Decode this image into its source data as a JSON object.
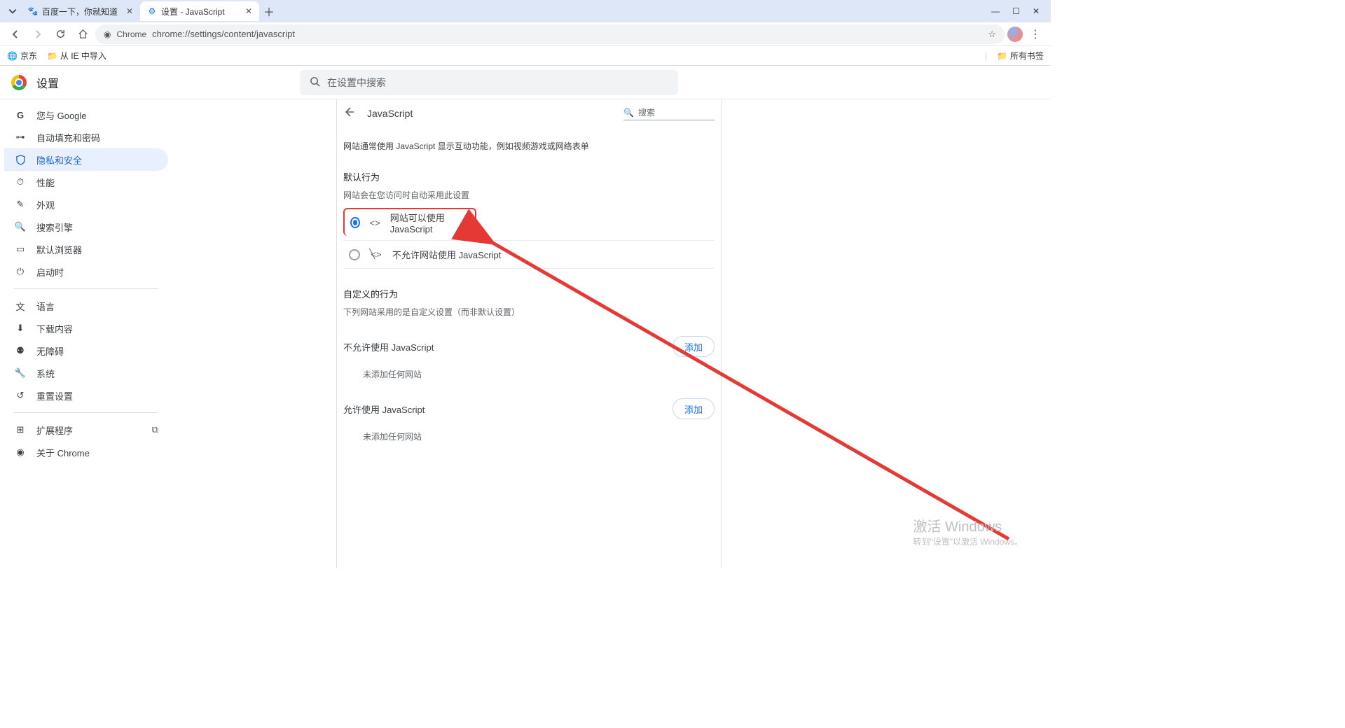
{
  "tabs": {
    "t1": {
      "title": "百度一下，你就知道"
    },
    "t2": {
      "title": "设置 - JavaScript"
    }
  },
  "addr": {
    "chip": "Chrome",
    "url": "chrome://settings/content/javascript"
  },
  "bookmarks": {
    "b1": "京东",
    "b2": "从 IE 中导入",
    "all": "所有书签"
  },
  "settings": {
    "title": "设置",
    "search_placeholder": "在设置中搜索"
  },
  "nav": {
    "google": "您与 Google",
    "autofill": "自动填充和密码",
    "privacy": "隐私和安全",
    "perf": "性能",
    "appearance": "外观",
    "search": "搜索引擎",
    "default_browser": "默认浏览器",
    "startup": "启动时",
    "lang": "语言",
    "downloads": "下载内容",
    "a11y": "无障碍",
    "system": "系统",
    "reset": "重置设置",
    "ext": "扩展程序",
    "about": "关于 Chrome"
  },
  "panel": {
    "title": "JavaScript",
    "search": "搜索",
    "desc": "网站通常使用 JavaScript 显示互动功能，例如视频游戏或网络表单",
    "default_title": "默认行为",
    "default_sub": "网站会在您访问时自动采用此设置",
    "opt_allow": "网站可以使用 JavaScript",
    "opt_block": "不允许网站使用 JavaScript",
    "custom_title": "自定义的行为",
    "custom_sub": "下列网站采用的是自定义设置（而非默认设置）",
    "block_header": "不允许使用 JavaScript",
    "allow_header": "允许使用 JavaScript",
    "add": "添加",
    "empty": "未添加任何网站"
  },
  "watermark": {
    "l1": "激活 Windows",
    "l2": "转到\"设置\"以激活 Windows。"
  }
}
